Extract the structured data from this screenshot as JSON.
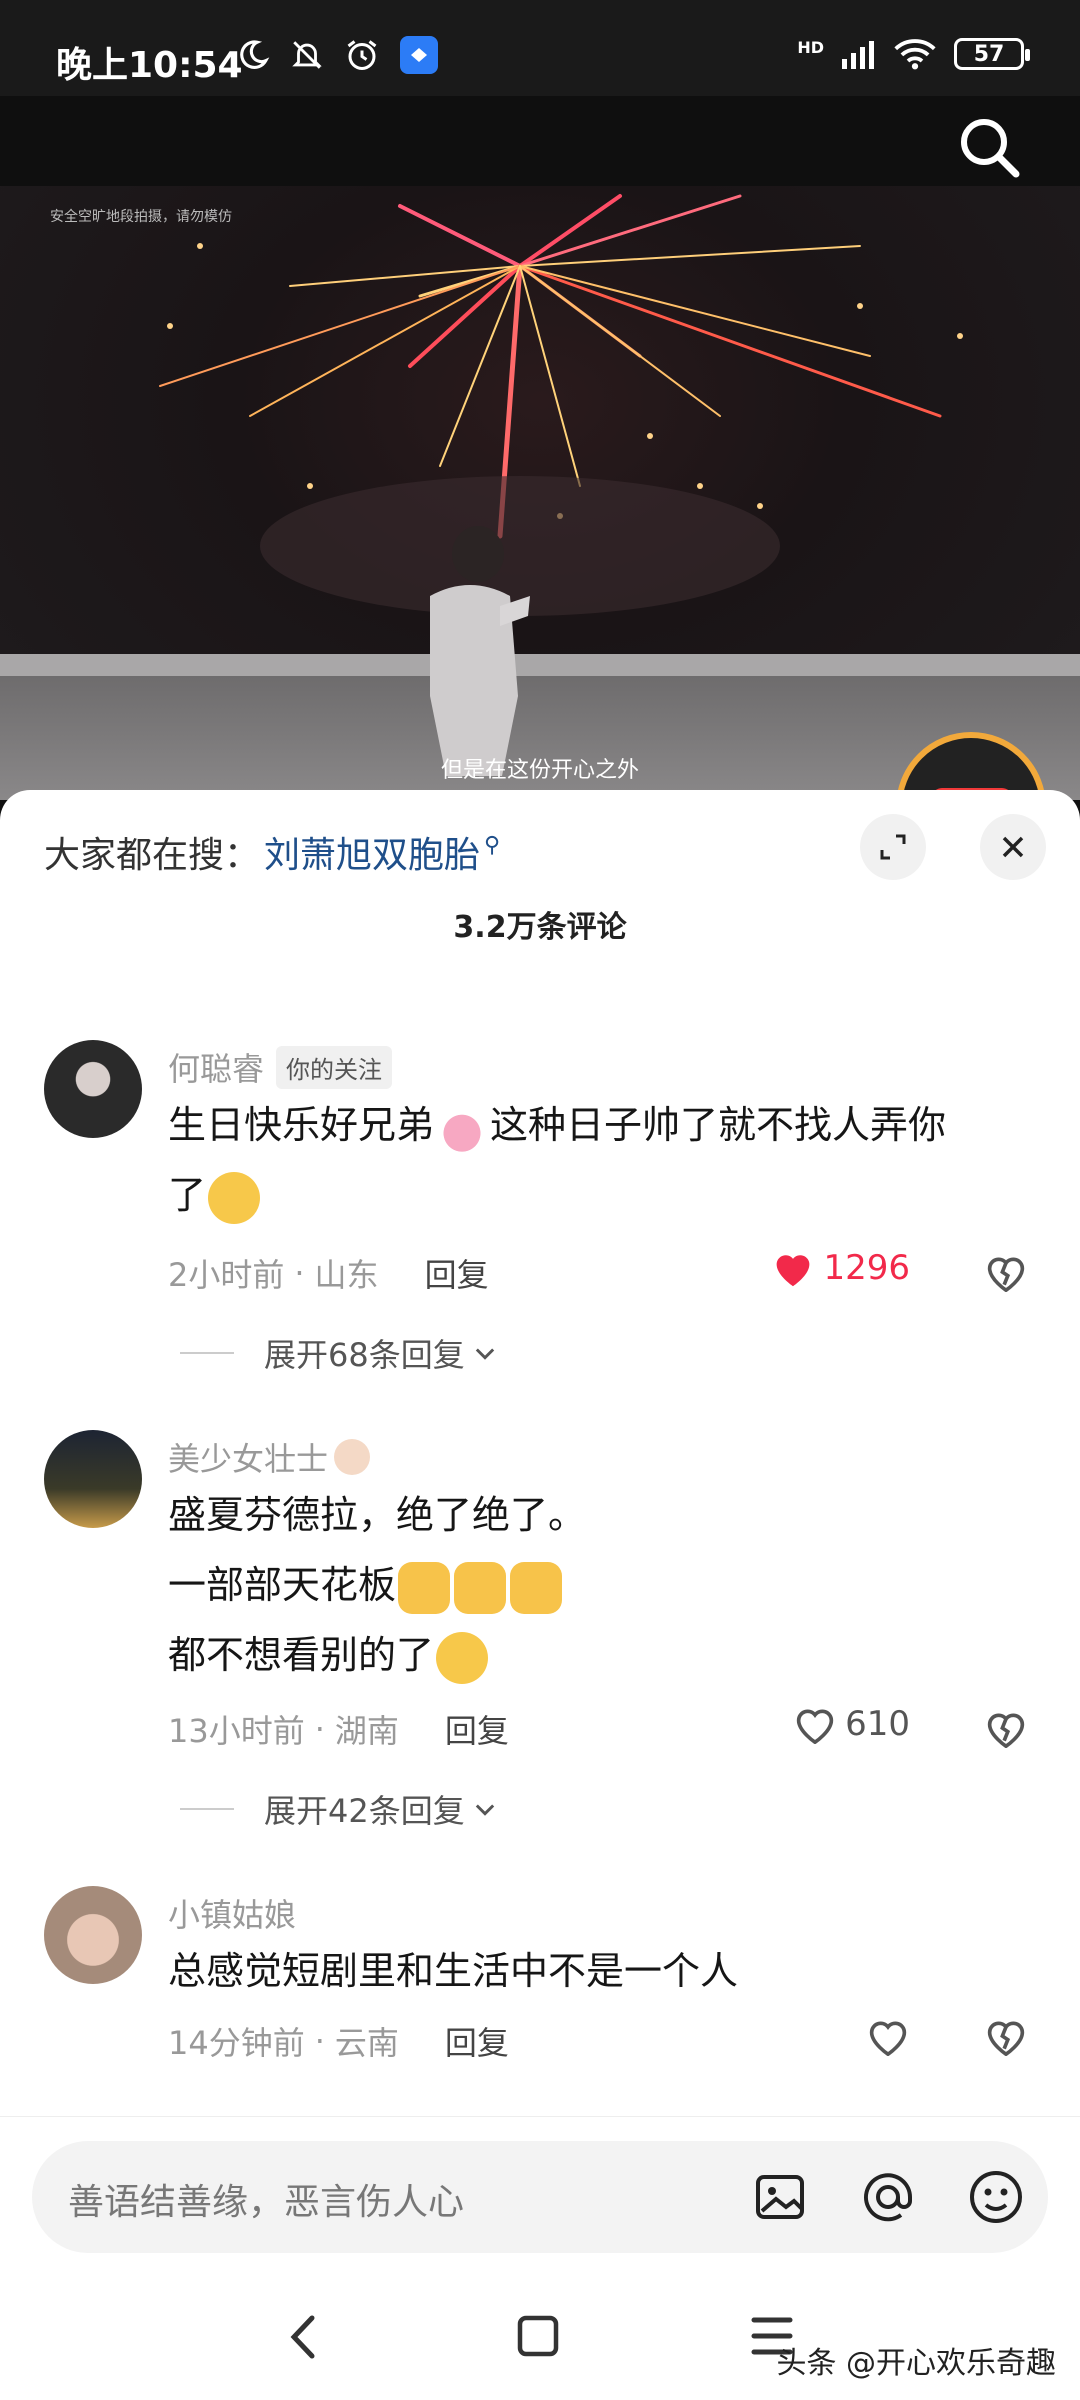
{
  "status_bar": {
    "time": "晚上10:54",
    "network": "HD",
    "battery": "57"
  },
  "video": {
    "warning": "安全空旷地段拍摄，请勿模仿",
    "subtitle": "但是在这份开心之外"
  },
  "sheet": {
    "hot_search_label": "大家都在搜：",
    "hot_search_keyword": "刘萧旭双胞胎",
    "comment_count": "3.2万条评论"
  },
  "comments": [
    {
      "user": "何聪睿",
      "tag": "你的关注",
      "line1": "生日快乐好兄弟",
      "line1b": "这种日子帅了就不找人弄你",
      "line2": "了",
      "time": "2小时前",
      "location": "山东",
      "reply": "回复",
      "likes": "1296",
      "liked": true,
      "expand": "展开68条回复"
    },
    {
      "user": "美少女壮士",
      "line1": "盛夏芬德拉，绝了绝了。",
      "line2": "一部部天花板",
      "line3": "都不想看别的了",
      "time": "13小时前",
      "location": "湖南",
      "reply": "回复",
      "likes": "610",
      "liked": false,
      "expand": "展开42条回复"
    },
    {
      "user": "小镇姑娘",
      "line1": "总感觉短剧里和生活中不是一个人",
      "time": "14分钟前",
      "location": "云南",
      "reply": "回复"
    }
  ],
  "input": {
    "placeholder": "善语结善缘，恶言伤人心"
  },
  "watermark": "头条 @开心欢乐奇趣",
  "colors": {
    "accent_like": "#f2294a",
    "keyword_link": "#1f4f8a"
  }
}
